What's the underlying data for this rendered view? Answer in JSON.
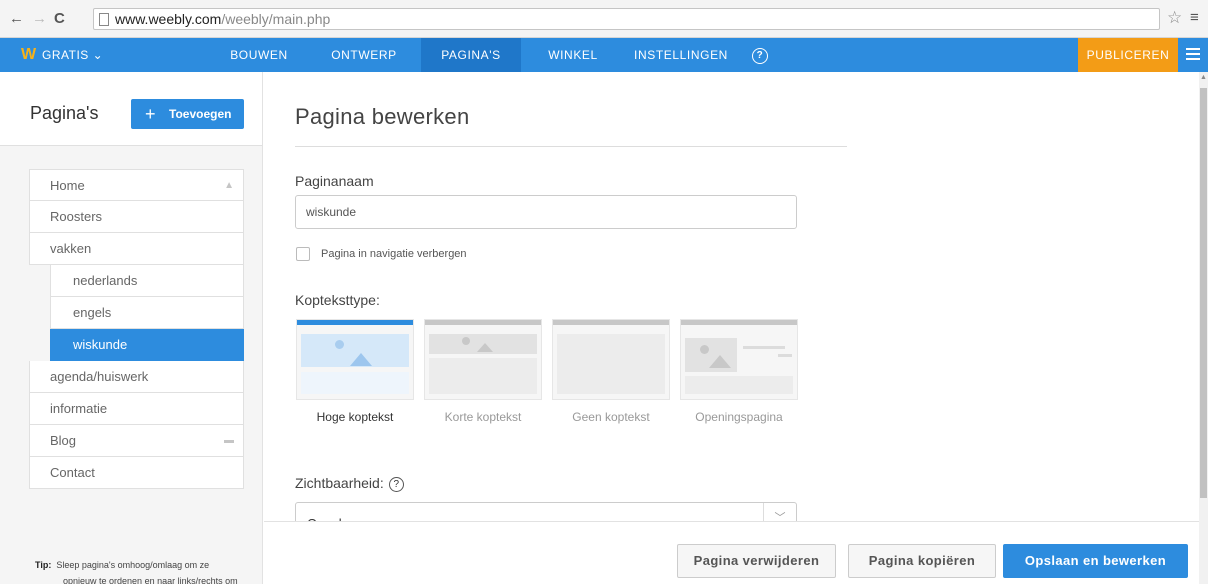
{
  "browser": {
    "url_host": "www.weebly.com",
    "url_path": "/weebly/main.php"
  },
  "topnav": {
    "plan": "GRATIS ⌄",
    "tabs": [
      "BOUWEN",
      "ONTWERP",
      "PAGINA'S",
      "WINKEL",
      "INSTELLINGEN"
    ],
    "active_tab": "PAGINA'S",
    "help": "?",
    "publish": "PUBLICEREN"
  },
  "sidebar": {
    "title": "Pagina's",
    "add_button": "Toevoegen",
    "pages": [
      {
        "label": "Home",
        "level": 0,
        "icon": "home-icon"
      },
      {
        "label": "Roosters",
        "level": 0
      },
      {
        "label": "vakken",
        "level": 0
      },
      {
        "label": "nederlands",
        "level": 1
      },
      {
        "label": "engels",
        "level": 1
      },
      {
        "label": "wiskunde",
        "level": 1,
        "selected": true
      },
      {
        "label": "agenda/huiswerk",
        "level": 0
      },
      {
        "label": "informatie",
        "level": 0
      },
      {
        "label": "Blog",
        "level": 0,
        "icon": "comment-icon"
      },
      {
        "label": "Contact",
        "level": 0
      }
    ],
    "tip_label": "Tip:",
    "tip_line1": "Sleep pagina's omhoog/omlaag om ze",
    "tip_line2": "opnieuw te ordenen en naar links/rechts om"
  },
  "main": {
    "title": "Pagina bewerken",
    "page_name_label": "Paginanaam",
    "page_name_value": "wiskunde",
    "hide_in_nav_label": "Pagina in navigatie verbergen",
    "hide_in_nav_checked": false,
    "header_type_label": "Kopteksttype:",
    "header_types": [
      "Hoge koptekst",
      "Korte koptekst",
      "Geen koptekst",
      "Openingspagina"
    ],
    "header_type_selected": "Hoge koptekst",
    "visibility_label": "Zichtbaarheid:",
    "visibility_value": "Openbaar"
  },
  "footer": {
    "delete": "Pagina verwijderen",
    "copy": "Pagina kopiëren",
    "save": "Opslaan en bewerken"
  },
  "colors": {
    "accent": "#2d8cde",
    "publish": "#f39c16",
    "logo": "#f5b21b"
  }
}
